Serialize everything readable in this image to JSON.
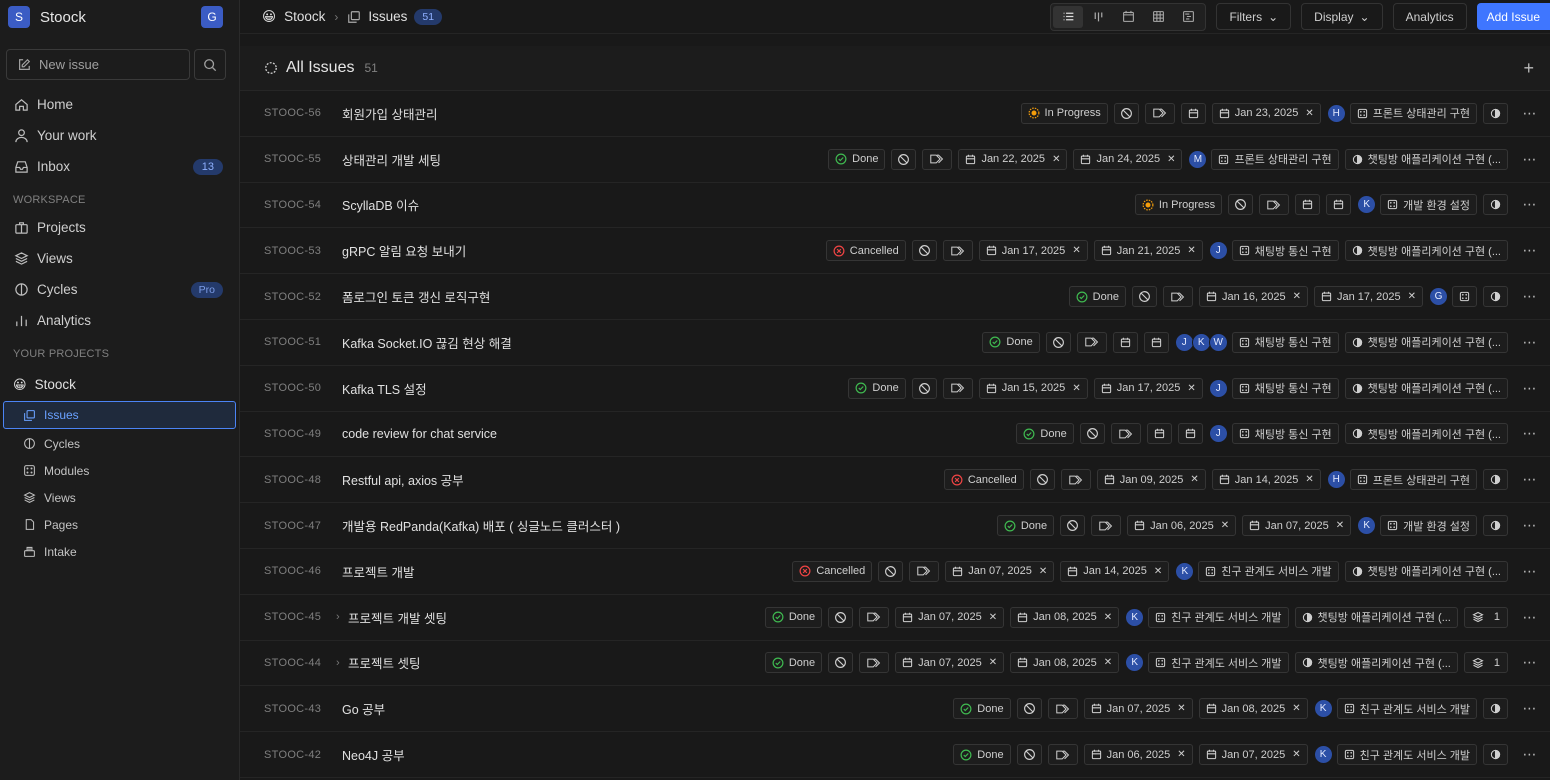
{
  "workspace": {
    "initial": "S",
    "name": "Stoock",
    "user_initial": "G"
  },
  "sidebar": {
    "new_issue_label": "New issue",
    "nav": [
      {
        "label": "Home",
        "icon": "home-icon"
      },
      {
        "label": "Your work",
        "icon": "user-icon"
      },
      {
        "label": "Inbox",
        "icon": "inbox-icon",
        "count": "13"
      }
    ],
    "workspace_label": "WORKSPACE",
    "workspace_items": [
      {
        "label": "Projects",
        "icon": "briefcase-icon"
      },
      {
        "label": "Views",
        "icon": "layers-icon"
      },
      {
        "label": "Cycles",
        "icon": "cycle-icon",
        "badge": "Pro"
      },
      {
        "label": "Analytics",
        "icon": "chart-icon"
      }
    ],
    "projects_label": "YOUR PROJECTS",
    "project": {
      "emoji": "😀",
      "name": "Stoock"
    },
    "project_items": [
      {
        "label": "Issues",
        "icon": "issues-icon",
        "active": true
      },
      {
        "label": "Cycles",
        "icon": "cycle-icon"
      },
      {
        "label": "Modules",
        "icon": "modules-icon"
      },
      {
        "label": "Views",
        "icon": "layers-icon"
      },
      {
        "label": "Pages",
        "icon": "pages-icon"
      },
      {
        "label": "Intake",
        "icon": "intake-icon"
      }
    ]
  },
  "topbar": {
    "project_emoji": "😀",
    "project_name": "Stoock",
    "section": "Issues",
    "section_count": "51",
    "filters_label": "Filters",
    "display_label": "Display",
    "analytics_label": "Analytics",
    "add_label": "Add Issue"
  },
  "list": {
    "title": "All Issues",
    "count": "51"
  },
  "issues": [
    {
      "id": "STOOC-56",
      "title": "회원가입 상태관리",
      "status": "In Progress",
      "start": "",
      "due": "Jan 23, 2025",
      "assignees": [
        "H"
      ],
      "module": "프론트 상태관리 구현",
      "cycle": "",
      "sub": ""
    },
    {
      "id": "STOOC-55",
      "title": "상태관리 개발 세팅",
      "status": "Done",
      "start": "Jan 22, 2025",
      "due": "Jan 24, 2025",
      "assignees": [
        "M"
      ],
      "module": "프론트 상태관리 구현",
      "cycle": "챗팅방 애플리케이션 구현 (...",
      "sub": ""
    },
    {
      "id": "STOOC-54",
      "title": "ScyllaDB 이슈",
      "status": "In Progress",
      "start": "",
      "due": "",
      "assignees": [
        "K"
      ],
      "module": "개발 환경 설정",
      "cycle": "",
      "sub": ""
    },
    {
      "id": "STOOC-53",
      "title": "gRPC 알림 요청 보내기",
      "status": "Cancelled",
      "start": "Jan 17, 2025",
      "due": "Jan 21, 2025",
      "assignees": [
        "J"
      ],
      "module": "채팅방 통신 구현",
      "cycle": "챗팅방 애플리케이션 구현 (...",
      "sub": ""
    },
    {
      "id": "STOOC-52",
      "title": "폼로그인 토큰 갱신 로직구현",
      "status": "Done",
      "start": "Jan 16, 2025",
      "due": "Jan 17, 2025",
      "assignees": [
        "G"
      ],
      "module": "",
      "cycle": "",
      "sub": ""
    },
    {
      "id": "STOOC-51",
      "title": "Kafka Socket.IO 끊김 현상 해결",
      "status": "Done",
      "start": "",
      "due": "",
      "assignees": [
        "J",
        "K",
        "W"
      ],
      "module": "채팅방 통신 구현",
      "cycle": "챗팅방 애플리케이션 구현 (...",
      "sub": ""
    },
    {
      "id": "STOOC-50",
      "title": "Kafka TLS 설정",
      "status": "Done",
      "start": "Jan 15, 2025",
      "due": "Jan 17, 2025",
      "assignees": [
        "J"
      ],
      "module": "채팅방 통신 구현",
      "cycle": "챗팅방 애플리케이션 구현 (...",
      "sub": ""
    },
    {
      "id": "STOOC-49",
      "title": "code review for chat service",
      "status": "Done",
      "start": "",
      "due": "",
      "assignees": [
        "J"
      ],
      "module": "채팅방 통신 구현",
      "cycle": "챗팅방 애플리케이션 구현 (...",
      "sub": ""
    },
    {
      "id": "STOOC-48",
      "title": "Restful api, axios 공부",
      "status": "Cancelled",
      "start": "Jan 09, 2025",
      "due": "Jan 14, 2025",
      "assignees": [
        "H"
      ],
      "module": "프론트 상태관리 구현",
      "cycle": "",
      "sub": ""
    },
    {
      "id": "STOOC-47",
      "title": "개발용 RedPanda(Kafka) 배포 ( 싱글노드 클러스터 )",
      "status": "Done",
      "start": "Jan 06, 2025",
      "due": "Jan 07, 2025",
      "assignees": [
        "K"
      ],
      "module": "개발 환경 설정",
      "cycle": "",
      "sub": ""
    },
    {
      "id": "STOOC-46",
      "title": "프로젝트 개발",
      "status": "Cancelled",
      "start": "Jan 07, 2025",
      "due": "Jan 14, 2025",
      "assignees": [
        "K"
      ],
      "module": "친구 관계도 서비스 개발",
      "cycle": "챗팅방 애플리케이션 구현 (...",
      "sub": ""
    },
    {
      "id": "STOOC-45",
      "title": "프로젝트 개발 셋팅",
      "status": "Done",
      "start": "Jan 07, 2025",
      "due": "Jan 08, 2025",
      "assignees": [
        "K"
      ],
      "module": "친구 관계도 서비스 개발",
      "cycle": "챗팅방 애플리케이션 구현 (...",
      "sub": "1",
      "expand": true
    },
    {
      "id": "STOOC-44",
      "title": "프로젝트 셋팅",
      "status": "Done",
      "start": "Jan 07, 2025",
      "due": "Jan 08, 2025",
      "assignees": [
        "K"
      ],
      "module": "친구 관계도 서비스 개발",
      "cycle": "챗팅방 애플리케이션 구현 (...",
      "sub": "1",
      "expand": true
    },
    {
      "id": "STOOC-43",
      "title": "Go 공부",
      "status": "Done",
      "start": "Jan 07, 2025",
      "due": "Jan 08, 2025",
      "assignees": [
        "K"
      ],
      "module": "친구 관계도 서비스 개발",
      "cycle": "",
      "sub": ""
    },
    {
      "id": "STOOC-42",
      "title": "Neo4J 공부",
      "status": "Done",
      "start": "Jan 06, 2025",
      "due": "Jan 07, 2025",
      "assignees": [
        "K"
      ],
      "module": "친구 관계도 서비스 개발",
      "cycle": "",
      "sub": ""
    }
  ],
  "colors": {
    "accent": "#3f76ff",
    "done": "#3fb950",
    "progress": "#f59e0b",
    "cancelled": "#ef4444",
    "avatar": "#2c4fa6"
  }
}
